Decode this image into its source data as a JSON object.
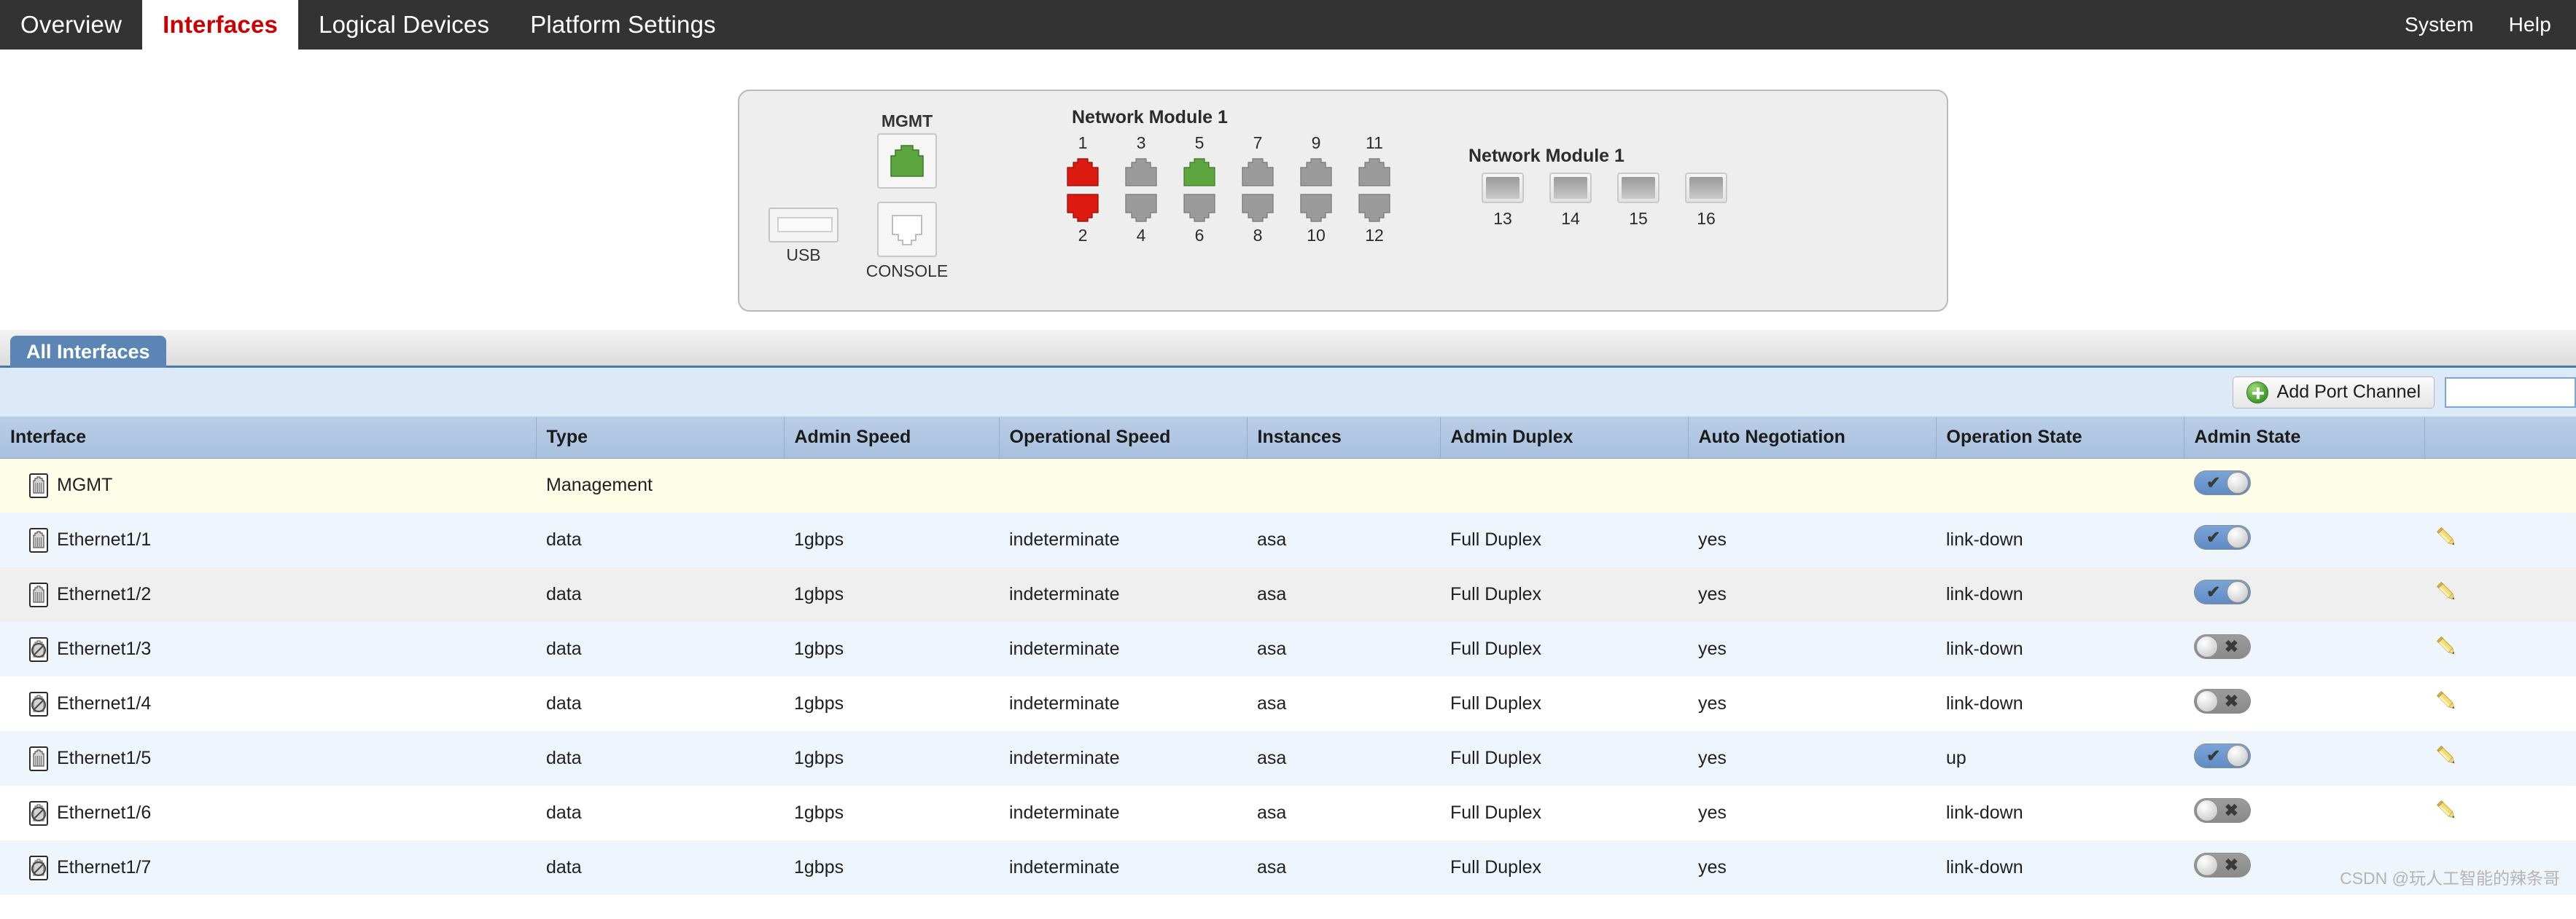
{
  "topnav": {
    "left_tabs": [
      {
        "label": "Overview",
        "active": false
      },
      {
        "label": "Interfaces",
        "active": true
      },
      {
        "label": "Logical Devices",
        "active": false
      },
      {
        "label": "Platform Settings",
        "active": false
      }
    ],
    "right_tabs": [
      {
        "label": "System"
      },
      {
        "label": "Help"
      }
    ]
  },
  "chassis": {
    "usb_label": "USB",
    "mgmt_label": "MGMT",
    "console_label": "CONSOLE",
    "mgmt_status_color": "#57a83c",
    "module1": {
      "title": "Network Module 1",
      "top_numbers": [
        "1",
        "3",
        "5",
        "7",
        "9",
        "11"
      ],
      "bottom_numbers": [
        "2",
        "4",
        "6",
        "8",
        "10",
        "12"
      ],
      "top_colors": [
        "#dd1a10",
        "#9b9b9b",
        "#5da53e",
        "#9b9b9b",
        "#9b9b9b",
        "#9b9b9b"
      ],
      "bottom_colors": [
        "#dd1a10",
        "#9b9b9b",
        "#9b9b9b",
        "#9b9b9b",
        "#9b9b9b",
        "#9b9b9b"
      ]
    },
    "module2": {
      "title": "Network Module 1",
      "numbers": [
        "13",
        "14",
        "15",
        "16"
      ]
    }
  },
  "tabs": {
    "all_interfaces": "All Interfaces"
  },
  "toolbar": {
    "add_port_channel_label": "Add Port Channel",
    "filter_value": "",
    "filter_placeholder": ""
  },
  "table": {
    "columns": [
      "Interface",
      "Type",
      "Admin Speed",
      "Operational Speed",
      "Instances",
      "Admin Duplex",
      "Auto Negotiation",
      "Operation State",
      "Admin State",
      ""
    ],
    "rows": [
      {
        "interface": "MGMT",
        "icon": "ethernet-port-icon",
        "type": "Management",
        "admin_speed": "",
        "operational_speed": "",
        "instances": "",
        "admin_duplex": "",
        "auto_negotiation": "",
        "operation_state": "",
        "admin_state": "on",
        "edit": false,
        "stripe": "row-mgmt"
      },
      {
        "interface": "Ethernet1/1",
        "icon": "ethernet-port-icon",
        "type": "data",
        "admin_speed": "1gbps",
        "operational_speed": "indeterminate",
        "instances": "asa",
        "admin_duplex": "Full Duplex",
        "auto_negotiation": "yes",
        "operation_state": "link-down",
        "admin_state": "on",
        "edit": true,
        "stripe": "row-a"
      },
      {
        "interface": "Ethernet1/2",
        "icon": "ethernet-port-icon",
        "type": "data",
        "admin_speed": "1gbps",
        "operational_speed": "indeterminate",
        "instances": "asa",
        "admin_duplex": "Full Duplex",
        "auto_negotiation": "yes",
        "operation_state": "link-down",
        "admin_state": "on",
        "edit": true,
        "stripe": "row-b"
      },
      {
        "interface": "Ethernet1/3",
        "icon": "ethernet-port-disabled-icon",
        "type": "data",
        "admin_speed": "1gbps",
        "operational_speed": "indeterminate",
        "instances": "asa",
        "admin_duplex": "Full Duplex",
        "auto_negotiation": "yes",
        "operation_state": "link-down",
        "admin_state": "off",
        "edit": true,
        "stripe": "row-a"
      },
      {
        "interface": "Ethernet1/4",
        "icon": "ethernet-port-disabled-icon",
        "type": "data",
        "admin_speed": "1gbps",
        "operational_speed": "indeterminate",
        "instances": "asa",
        "admin_duplex": "Full Duplex",
        "auto_negotiation": "yes",
        "operation_state": "link-down",
        "admin_state": "off",
        "edit": true,
        "stripe": "row-c"
      },
      {
        "interface": "Ethernet1/5",
        "icon": "ethernet-port-icon",
        "type": "data",
        "admin_speed": "1gbps",
        "operational_speed": "indeterminate",
        "instances": "asa",
        "admin_duplex": "Full Duplex",
        "auto_negotiation": "yes",
        "operation_state": "up",
        "admin_state": "on",
        "edit": true,
        "stripe": "row-a"
      },
      {
        "interface": "Ethernet1/6",
        "icon": "ethernet-port-disabled-icon",
        "type": "data",
        "admin_speed": "1gbps",
        "operational_speed": "indeterminate",
        "instances": "asa",
        "admin_duplex": "Full Duplex",
        "auto_negotiation": "yes",
        "operation_state": "link-down",
        "admin_state": "off",
        "edit": true,
        "stripe": "row-c"
      },
      {
        "interface": "Ethernet1/7",
        "icon": "ethernet-port-disabled-icon",
        "type": "data",
        "admin_speed": "1gbps",
        "operational_speed": "indeterminate",
        "instances": "asa",
        "admin_duplex": "Full Duplex",
        "auto_negotiation": "yes",
        "operation_state": "link-down",
        "admin_state": "off",
        "edit": false,
        "stripe": "row-a"
      }
    ]
  },
  "watermark": {
    "text": "CSDN @玩人工智能的辣条哥"
  }
}
